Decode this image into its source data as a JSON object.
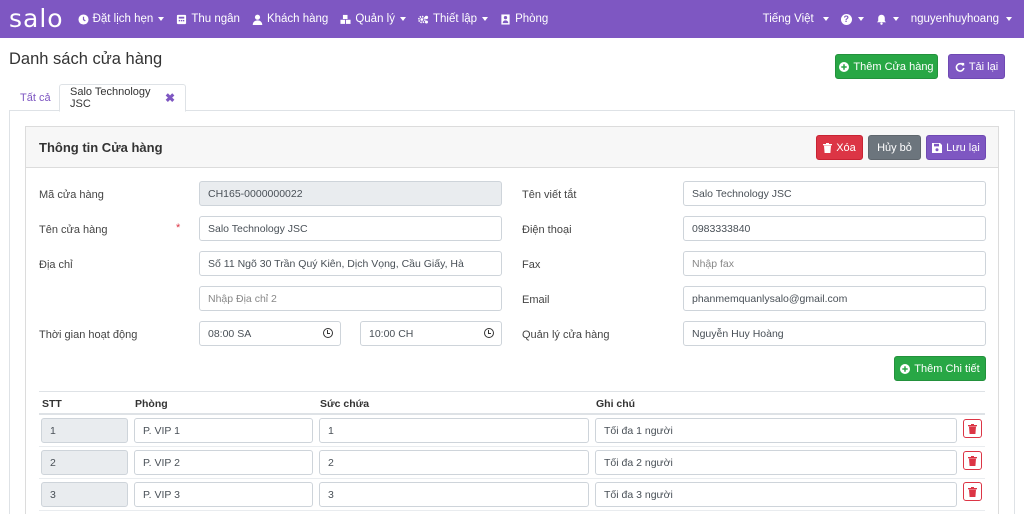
{
  "navbar": {
    "logo": "salo",
    "items": [
      {
        "label": "Đặt lịch hẹn",
        "icon": "clock-icon",
        "dropdown": true
      },
      {
        "label": "Thu ngân",
        "icon": "cash-register-icon",
        "dropdown": false
      },
      {
        "label": "Khách hàng",
        "icon": "user-icon",
        "dropdown": false
      },
      {
        "label": "Quản lý",
        "icon": "cubes-icon",
        "dropdown": true
      },
      {
        "label": "Thiết lập",
        "icon": "cogs-icon",
        "dropdown": true
      },
      {
        "label": "Phòng",
        "icon": "person-icon",
        "dropdown": false
      }
    ],
    "language": "Tiếng Việt",
    "username": "nguyenhuyhoang"
  },
  "header": {
    "title": "Danh sách cửa hàng",
    "add_store_label": "Thêm Cửa hàng",
    "reload_label": "Tải lại"
  },
  "tabs": [
    {
      "label": "Tất cả"
    },
    {
      "label": "Salo Technology JSC"
    }
  ],
  "card": {
    "title": "Thông tin Cửa hàng",
    "delete_label": "Xóa",
    "cancel_label": "Hủy bỏ",
    "save_label": "Lưu lại"
  },
  "form": {
    "store_code_label": "Mã cửa hàng",
    "store_code_value": "CH165-0000000022",
    "store_name_label": "Tên cửa hàng",
    "required_mark": "*",
    "store_name_value": "Salo Technology JSC",
    "address_label": "Địa chỉ",
    "address_value": "Số 11 Ngõ 30 Trần Quý Kiên, Dịch Vọng, Cầu Giấy, Hà",
    "address2_placeholder": "Nhập Địa chỉ 2",
    "hours_label": "Thời gian hoạt động",
    "open_time": "08:00 SA",
    "close_time": "10:00 CH",
    "short_name_label": "Tên viết tắt",
    "short_name_value": "Salo Technology JSC",
    "phone_label": "Điện thoại",
    "phone_value": "0983333840",
    "fax_label": "Fax",
    "fax_placeholder": "Nhập fax",
    "email_label": "Email",
    "email_value": "phanmemquanlysalo@gmail.com",
    "manager_label": "Quản lý cửa hàng",
    "manager_value": "Nguyễn Huy Hoàng",
    "add_detail_label": "Thêm Chi tiết"
  },
  "table": {
    "headers": [
      "STT",
      "Phòng",
      "Sức chứa",
      "Ghi chú"
    ],
    "rows": [
      {
        "stt": "1",
        "room": "P. VIP 1",
        "capacity": "1",
        "note": "Tối đa 1 người"
      },
      {
        "stt": "2",
        "room": "P. VIP 2",
        "capacity": "2",
        "note": "Tối đa 2 người"
      },
      {
        "stt": "3",
        "room": "P. VIP 3",
        "capacity": "3",
        "note": "Tối đa 3 người"
      }
    ]
  },
  "colors": {
    "brand": "#7e57c2",
    "success": "#28a745",
    "danger": "#dc3545",
    "secondary": "#6c757d"
  }
}
